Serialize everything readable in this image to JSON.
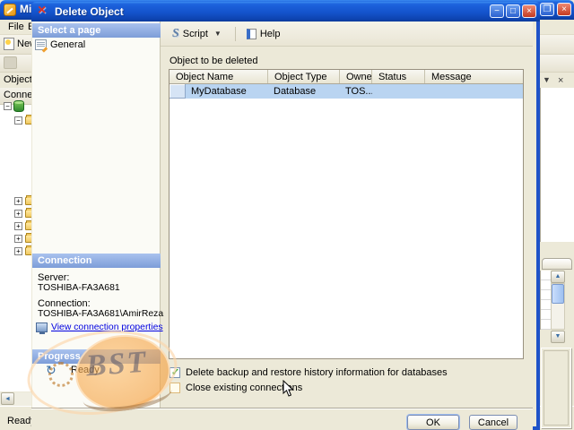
{
  "colors": {
    "titlebar_blue": "#1453cc",
    "client_beige": "#ece9d8",
    "selection_blue": "#b9d4f1",
    "watermark_orange": "#f09128",
    "link_blue": "#0000e0"
  },
  "main_window": {
    "title": "Micr",
    "menu_items": [
      "File",
      "E"
    ],
    "new_button_label": "New",
    "object_explorer_title": "Object Ex",
    "connect_label": "Connect",
    "status_text": "Ready"
  },
  "dialog": {
    "title": "Delete Object",
    "toolbar": {
      "script_label": "Script",
      "help_label": "Help"
    },
    "left_panel": {
      "select_page_header": "Select a page",
      "pages": [
        {
          "label": "General"
        }
      ],
      "connection_header": "Connection",
      "server_label": "Server:",
      "server_value": "TOSHIBA-FA3A681",
      "connection_label": "Connection:",
      "connection_value": "TOSHIBA-FA3A681\\AmirReza",
      "view_connection_link": "View connection properties",
      "progress_header": "Progress",
      "progress_status": "Ready"
    },
    "content": {
      "section_label": "Object to be deleted",
      "table": {
        "columns": [
          "Object Name",
          "Object Type",
          "Owner",
          "Status",
          "Message"
        ],
        "rows": [
          {
            "object_name": "MyDatabase",
            "object_type": "Database",
            "owner": "TOS...",
            "status": "",
            "message": ""
          }
        ]
      },
      "checkboxes": [
        {
          "label": "Delete backup and restore history information for databases",
          "checked": true
        },
        {
          "label": "Close existing connections",
          "checked": false
        }
      ]
    },
    "footer": {
      "ok_label": "OK",
      "cancel_label": "Cancel"
    }
  },
  "watermark": {
    "text": "BST"
  }
}
